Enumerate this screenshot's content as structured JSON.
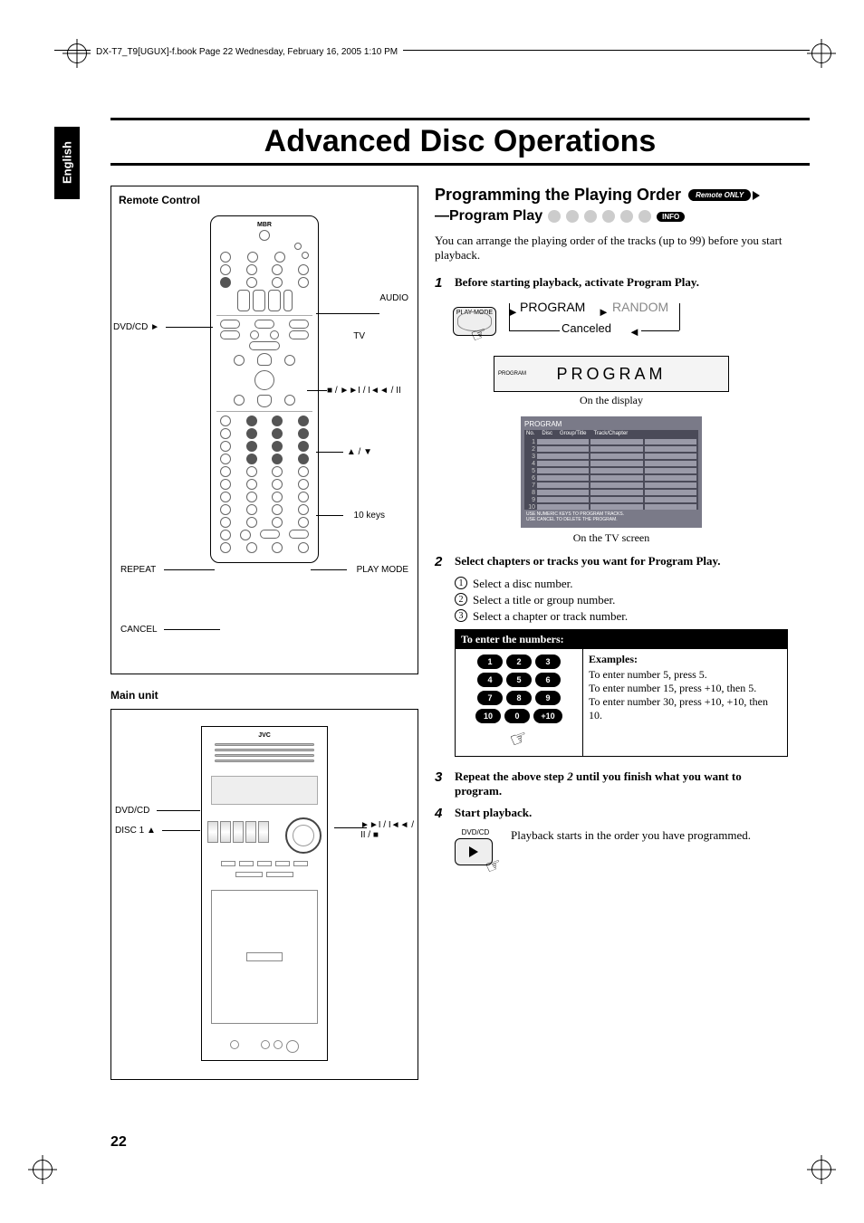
{
  "header_line": "DX-T7_T9[UGUX]-f.book  Page 22  Wednesday, February 16, 2005  1:10 PM",
  "lang_tab": "English",
  "page_title": "Advanced Disc Operations",
  "page_number": "22",
  "remote_panel": {
    "title": "Remote Control",
    "top_label": "MBR",
    "labels": {
      "dvdcd": "DVD/CD ►",
      "audio": "AUDIO",
      "tv": "TV",
      "transport": "■ / ►►I / I◄◄ / II",
      "updown": "▲ / ▼",
      "tenkeys": "10 keys",
      "repeat": "REPEAT",
      "playmode": "PLAY MODE",
      "cancel": "CANCEL"
    }
  },
  "mainunit_panel": {
    "title": "Main unit",
    "logo": "JVC",
    "labels": {
      "dvdcd": "DVD/CD",
      "disc1": "DISC 1 ▲",
      "transport": "►►I / I◄◄ /",
      "transport2": "II / ■"
    }
  },
  "program_section": {
    "title": "Programming the Playing Order",
    "subtitle": "—Program Play",
    "remote_only": "Remote ONLY",
    "info": "INFO",
    "intro": "You can arrange the playing order of the tracks (up to 99) before you start playback.",
    "step1": "Before starting playback, activate Program Play.",
    "playmode_btn": "PLAY MODE",
    "flow": {
      "program": "PROGRAM",
      "random": "RANDOM",
      "canceled": "Canceled"
    },
    "lcd_text": "PROGRAM",
    "lcd_side": "PROGRAM",
    "on_display": "On the display",
    "on_tv": "On the TV screen",
    "tv": {
      "title": "PROGRAM",
      "headers": [
        "No.",
        "Disc",
        "Group/Title",
        "Track/Chapter"
      ],
      "rows": [
        "1",
        "2",
        "3",
        "4",
        "5",
        "6",
        "7",
        "8",
        "9",
        "10"
      ],
      "foot1": "USE NUMERIC KEYS TO PROGRAM TRACKS.",
      "foot2": "USE CANCEL TO DELETE THE PROGRAM."
    },
    "step2": "Select chapters or tracks you want for Program Play.",
    "substeps": [
      "Select a disc number.",
      "Select a title or group number.",
      "Select a chapter or track number."
    ],
    "enter_head": "To enter the numbers:",
    "keypad": [
      "1",
      "2",
      "3",
      "4",
      "5",
      "6",
      "7",
      "8",
      "9",
      "10",
      "0",
      "+10"
    ],
    "examples_title": "Examples:",
    "examples": [
      "To enter number 5, press 5.",
      "To enter number 15, press +10, then 5.",
      "To enter number 30, press +10, +10, then 10."
    ],
    "step3_a": "Repeat the above step ",
    "step3_b": " until you finish what you want to program.",
    "step3_ref": "2",
    "step4": "Start playback.",
    "play_lbl": "DVD/CD",
    "play_text": "Playback starts in the order you have programmed."
  }
}
